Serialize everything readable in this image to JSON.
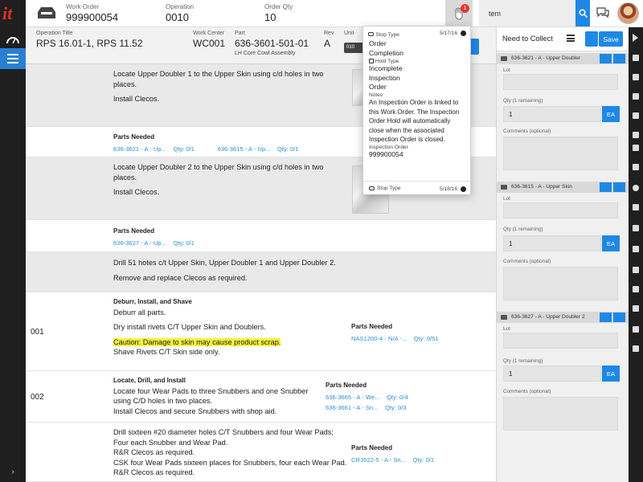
{
  "topbar": {
    "work_order_label": "Work Order",
    "work_order_value": "999900054",
    "operation_label": "Operation",
    "operation_value": "0010",
    "order_qty_label": "Order Qty",
    "order_qty_value": "10",
    "notification_count": "1",
    "search_value": "tem"
  },
  "operation": {
    "title_label": "Operation Title",
    "title_value": "RPS 16.01-1, RPS 11.52",
    "work_center_label": "Work Center",
    "work_center_value": "WC001",
    "part_label": "Part",
    "part_value": "636-3601-501-01",
    "part_desc": "LH Core Cowl Assembly",
    "rev_label": "Rev",
    "rev_value": "A",
    "unit_label": "Unit",
    "unit_value": "010"
  },
  "steps": {
    "s1": {
      "line1": "Locate Upper Doubler 1 to the Upper Skin using c/d holes in two",
      "line2": "places.",
      "line3": "Install Clecos."
    },
    "p1": {
      "title": "Parts Needed",
      "link1": "636-3621 - A - Up...",
      "qty1": "Qty: 0/1",
      "link2": "636-3615 - A - Up...",
      "qty2": "Qty: 0/1"
    },
    "s2": {
      "line1": "Locate Upper Doubler 2 to the Upper Skin using c/d holes in two",
      "line2": "places.",
      "line3": "Install Clecos."
    },
    "p2": {
      "title": "Parts Needed",
      "link1": "636-3627 - A - Up...",
      "qty1": "Qty: 0/1"
    },
    "s3": {
      "line1": "Drill 51 hotes c/t Upper Skin, Upper Doubler 1 and Upper Doubler 2.",
      "line2": "Remove and replace Clecos as required."
    },
    "s4": {
      "number": "001",
      "heading": "Deburr, Install, and Shave",
      "line1": "Deburr all parts.",
      "line2": "Dry install rivets C/T Upper Skin and Doublers.",
      "caution": "Caution: Damage to skin may cause product scrap.",
      "line3": "Shave Rivets C/T Skin side only.",
      "parts_title": "Parts Needed",
      "link1": "NAS1200-4 - N/A -...",
      "qty1": "Qty: 0/51"
    },
    "s5": {
      "number": "002",
      "heading": "Locate, Drill, and Install",
      "line1": "Locate four Wear Pads to three Snubbers and one Snubber",
      "line2": "using C/D holes in two places.",
      "line3": "Install Clecos and secure Snubbers with shop aid.",
      "parts_title": "Parts Needed",
      "link1": "636-3665 - A - We...",
      "qty1": "Qty: 0/4",
      "link2": "636-3661 - A - Sn...",
      "qty2": "Qty: 0/3"
    },
    "s6": {
      "line1": "Drill sixteen #20 diameter holes C/T Snubbers and four Wear Pads;",
      "line2": "Four each Snubber and Wear Pad.",
      "line3": "R&R Clecos as required.",
      "line4": "CSK four Wear Pads sixteen places for Snubbers, four each Wear Pad.",
      "line5": "R&R Clecos as required.",
      "parts_title": "Parts Needed",
      "link1": "CR3522-5 - A - Sn...",
      "qty1": "Qty: 0/1"
    }
  },
  "popover": {
    "stop_type_label": "Stop Type",
    "date1": "5/17/16",
    "order_line1": "Order",
    "order_line2": "Completion",
    "hold_type_label": "Hold Type",
    "hold_line1": "Incomplete",
    "hold_line2": "Inspection",
    "hold_line3": "Order",
    "notes_label": "Notes",
    "note1": "An Inspection Order is linked to",
    "note2": "this Work Order. The Inspection",
    "note3": "Order Hold will automatically",
    "note4": "close when the associated",
    "note5": "Inspection Order is closed.",
    "io_label": "Inspection Order",
    "io_value": "999900054",
    "footer_label": "Stop Type",
    "date2": "5/18/16"
  },
  "need_to_collect": {
    "title": "Need to Collect",
    "save_label": "Save",
    "lot_label": "Lot",
    "qty_label": "Qty (1 remaining)",
    "qty_value": "1",
    "uom": "EA",
    "comments_label": "Comments (optional)",
    "card1_title": "636-3621 - A - Upper Doubler",
    "card2_title": "636-3615 - A - Upper Skin",
    "card3_title": "636-3627 - A - Upper Doubler 2"
  },
  "colors": {
    "accent": "#1e88e5",
    "link": "#2b8fd6",
    "caution": "#f6f23a",
    "rail": "#1f1f1f",
    "badge": "#e53935"
  }
}
